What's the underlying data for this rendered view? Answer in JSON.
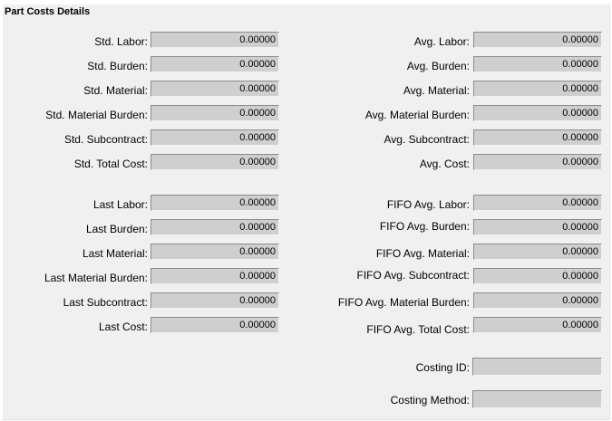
{
  "title": "Part Costs Details",
  "left": [
    {
      "label": "Std. Labor:",
      "value": "0.00000"
    },
    {
      "label": "Std. Burden:",
      "value": "0.00000"
    },
    {
      "label": "Std. Material:",
      "value": "0.00000"
    },
    {
      "label": "Std. Material Burden:",
      "value": "0.00000"
    },
    {
      "label": "Std. Subcontract:",
      "value": "0.00000"
    },
    {
      "label": "Std. Total Cost:",
      "value": "0.00000"
    },
    {
      "label": "Last Labor:",
      "value": "0.00000"
    },
    {
      "label": "Last Burden:",
      "value": "0.00000"
    },
    {
      "label": "Last Material:",
      "value": "0.00000"
    },
    {
      "label": "Last Material Burden:",
      "value": "0.00000"
    },
    {
      "label": "Last Subcontract:",
      "value": "0.00000"
    },
    {
      "label": "Last Cost:",
      "value": "0.00000"
    }
  ],
  "right": [
    {
      "label": "Avg. Labor:",
      "value": "0.00000"
    },
    {
      "label": "Avg. Burden:",
      "value": "0.00000"
    },
    {
      "label": "Avg. Material:",
      "value": "0.00000"
    },
    {
      "label": "Avg. Material Burden:",
      "value": "0.00000"
    },
    {
      "label": "Avg. Subcontract:",
      "value": "0.00000"
    },
    {
      "label": "Avg. Cost:",
      "value": "0.00000"
    },
    {
      "label": "FIFO Avg. Labor:",
      "value": "0.00000"
    },
    {
      "label": "FIFO Avg. Burden:",
      "value": "0.00000"
    },
    {
      "label": "FIFO Avg. Material:",
      "value": "0.00000"
    },
    {
      "label": "FIFO Avg. Subcontract:",
      "value": "0.00000"
    },
    {
      "label": "FIFO Avg. Material Burden:",
      "value": "0.00000"
    },
    {
      "label": "FIFO Avg. Total Cost:",
      "value": "0.00000"
    },
    {
      "label": "Costing ID:",
      "value": ""
    },
    {
      "label": "Costing Method:",
      "value": ""
    }
  ]
}
